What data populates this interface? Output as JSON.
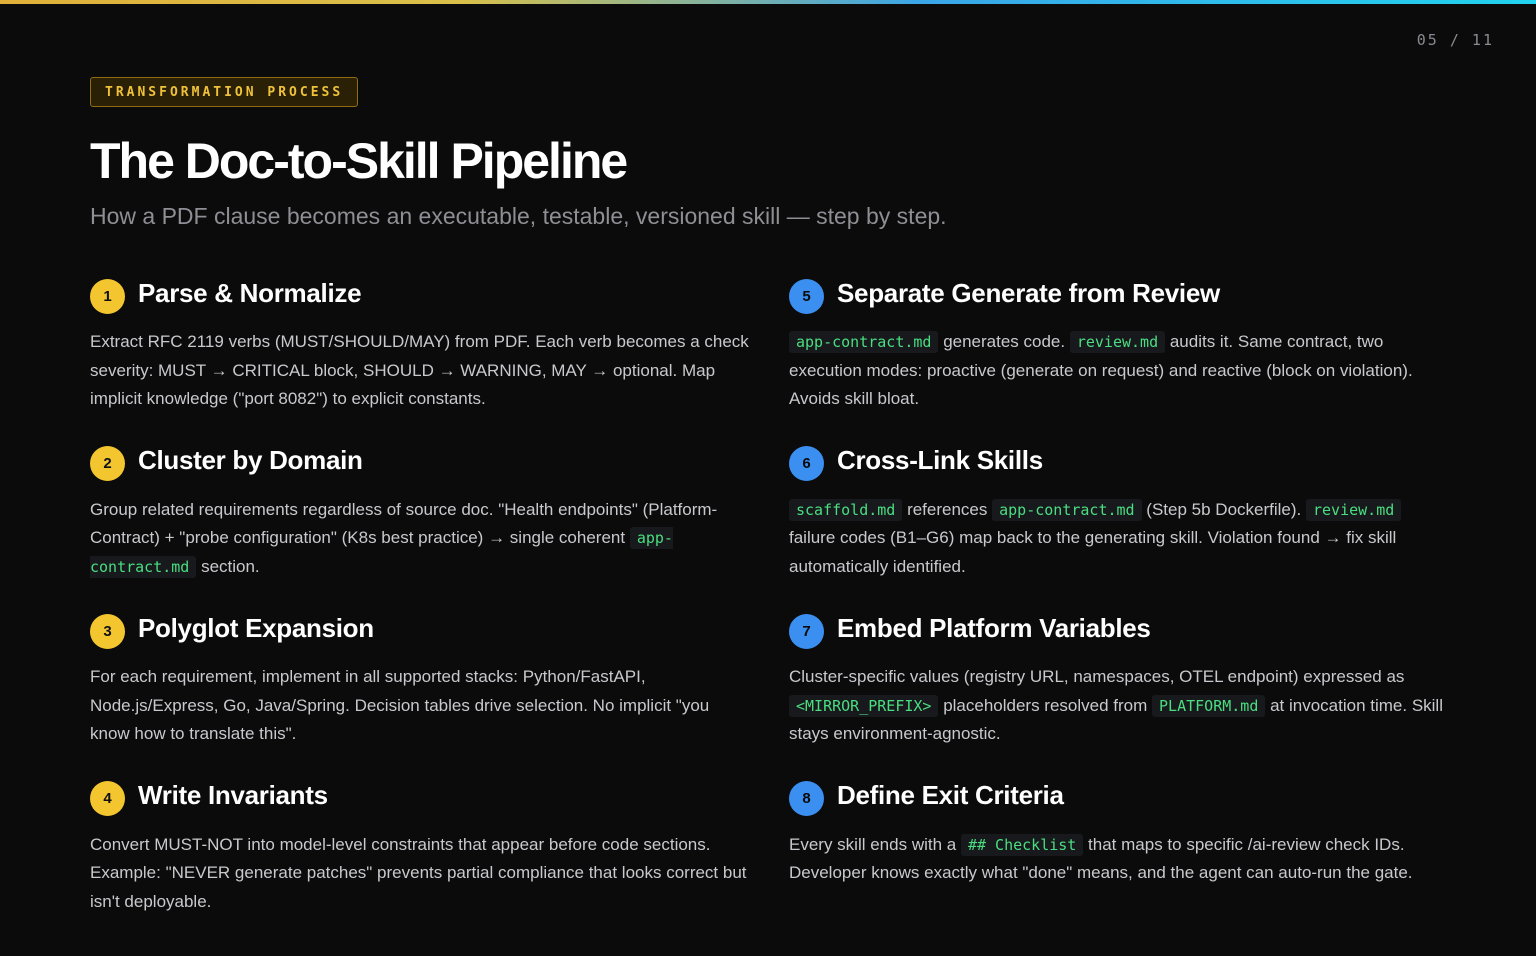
{
  "counter": "05 / 11",
  "tag": "TRANSFORMATION PROCESS",
  "title": "The Doc-to-Skill Pipeline",
  "subtitle": "How a PDF clause becomes an executable, testable, versioned skill — step by step.",
  "colors": {
    "accent_yellow": "#f3c62f",
    "accent_blue": "#3b8ff0",
    "code_green": "#4ade80"
  },
  "steps": [
    {
      "num": "1",
      "title": "Parse & Normalize",
      "body": [
        {
          "t": "Extract RFC 2119 verbs (MUST/SHOULD/MAY) from PDF. Each verb becomes a check severity: MUST → CRITICAL block, SHOULD → WARNING, MAY → optional. Map implicit knowledge (\"port 8082\") to explicit constants."
        }
      ]
    },
    {
      "num": "2",
      "title": "Cluster by Domain",
      "body": [
        {
          "t": "Group related requirements regardless of source doc. \"Health endpoints\" (Platform-Contract) + \"probe configuration\" (K8s best practice) → single coherent "
        },
        {
          "c": "app-contract.md"
        },
        {
          "t": " section."
        }
      ]
    },
    {
      "num": "3",
      "title": "Polyglot Expansion",
      "body": [
        {
          "t": "For each requirement, implement in all supported stacks: Python/FastAPI, Node.js/Express, Go, Java/Spring. Decision tables drive selection. No implicit \"you know how to translate this\"."
        }
      ]
    },
    {
      "num": "4",
      "title": "Write Invariants",
      "body": [
        {
          "t": "Convert MUST-NOT into model-level constraints that appear before code sections. Example: \"NEVER generate patches\" prevents partial compliance that looks correct but isn't deployable."
        }
      ]
    },
    {
      "num": "5",
      "title": "Separate Generate from Review",
      "body": [
        {
          "c": "app-contract.md"
        },
        {
          "t": " generates code. "
        },
        {
          "c": "review.md"
        },
        {
          "t": " audits it. Same contract, two execution modes: proactive (generate on request) and reactive (block on violation). Avoids skill bloat."
        }
      ]
    },
    {
      "num": "6",
      "title": "Cross-Link Skills",
      "body": [
        {
          "c": "scaffold.md"
        },
        {
          "t": " references "
        },
        {
          "c": "app-contract.md"
        },
        {
          "t": " (Step 5b Dockerfile). "
        },
        {
          "c": "review.md"
        },
        {
          "t": " failure codes (B1–G6) map back to the generating skill. Violation found → fix skill automatically identified."
        }
      ]
    },
    {
      "num": "7",
      "title": "Embed Platform Variables",
      "body": [
        {
          "t": "Cluster-specific values (registry URL, namespaces, OTEL endpoint) expressed as "
        },
        {
          "c": "<MIRROR_PREFIX>"
        },
        {
          "t": " placeholders resolved from "
        },
        {
          "c": "PLATFORM.md"
        },
        {
          "t": " at invocation time. Skill stays environment-agnostic."
        }
      ]
    },
    {
      "num": "8",
      "title": "Define Exit Criteria",
      "body": [
        {
          "t": "Every skill ends with a "
        },
        {
          "c": "## Checklist"
        },
        {
          "t": " that maps to specific /ai-review check IDs. Developer knows exactly what \"done\" means, and the agent can auto-run the gate."
        }
      ]
    }
  ]
}
